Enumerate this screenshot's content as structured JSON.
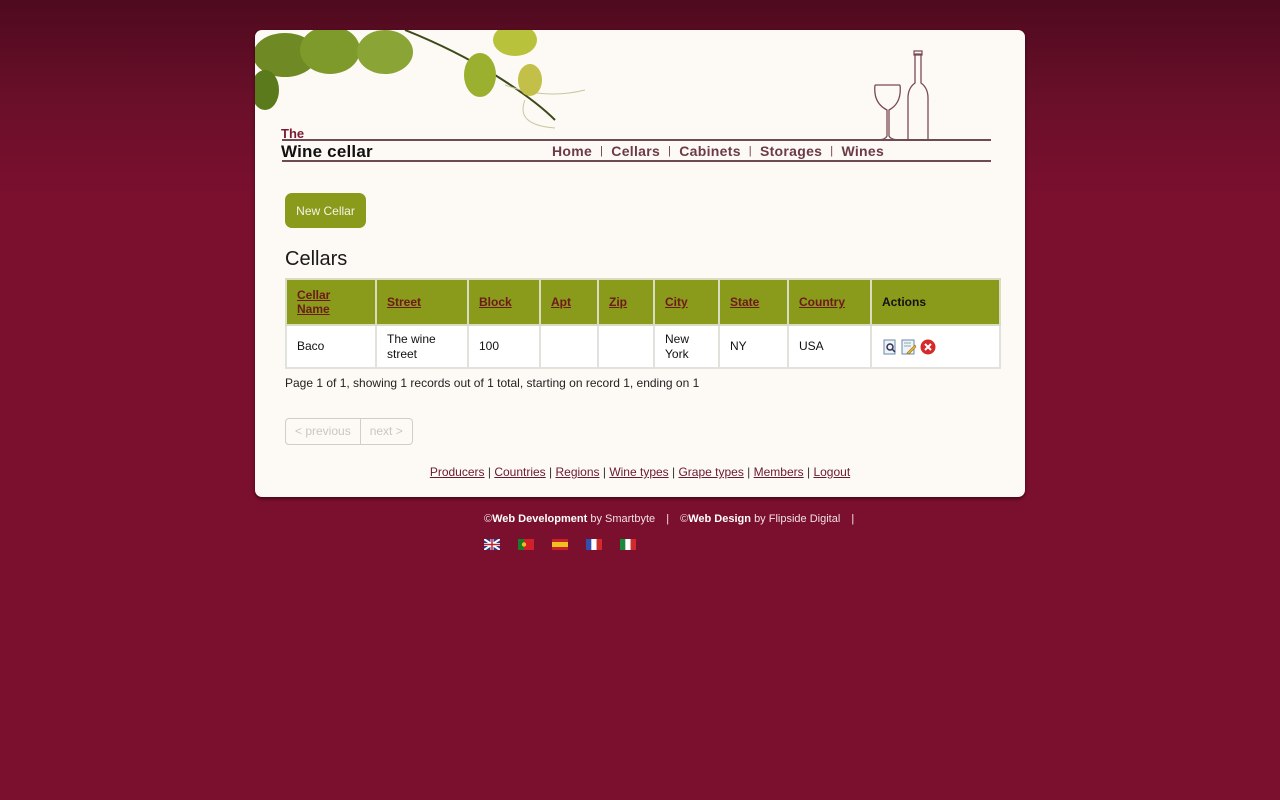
{
  "header": {
    "logo_the": "The",
    "logo_name": "Wine cellar",
    "nav": [
      "Home",
      "Cellars",
      "Cabinets",
      "Storages",
      "Wines"
    ]
  },
  "main": {
    "new_button": "New Cellar",
    "title": "Cellars",
    "table": {
      "columns": [
        "Cellar Name",
        "Street",
        "Block",
        "Apt",
        "Zip",
        "City",
        "State",
        "Country",
        "Actions"
      ],
      "rows": [
        {
          "cellar_name": "Baco",
          "street": "The wine street",
          "block": "100",
          "apt": "",
          "zip": "",
          "city": "New York",
          "state": "NY",
          "country": "USA",
          "actions": [
            "view-icon",
            "edit-icon",
            "delete-icon"
          ]
        }
      ]
    },
    "paging_info": "Page 1 of 1, showing 1 records out of 1 total, starting on record 1, ending on 1",
    "pager": {
      "previous": "< previous",
      "next": "next >"
    }
  },
  "bottom_links": [
    "Producers",
    "Countries",
    "Regions",
    "Wine types",
    "Grape types",
    "Members",
    "Logout"
  ],
  "footer": {
    "dev_label": "Web Development",
    "dev_by": "by Smartbyte",
    "design_label": "Web Design",
    "design_by": "by Flipside Digital",
    "copyright": "©",
    "languages": [
      "English",
      "Portuguese",
      "Spanish",
      "French",
      "Italian"
    ]
  },
  "colors": {
    "background": "#7b0f2e",
    "page": "#fdf9f4",
    "accent_green": "#8a9a1a",
    "nav_text": "#6b3b49"
  }
}
